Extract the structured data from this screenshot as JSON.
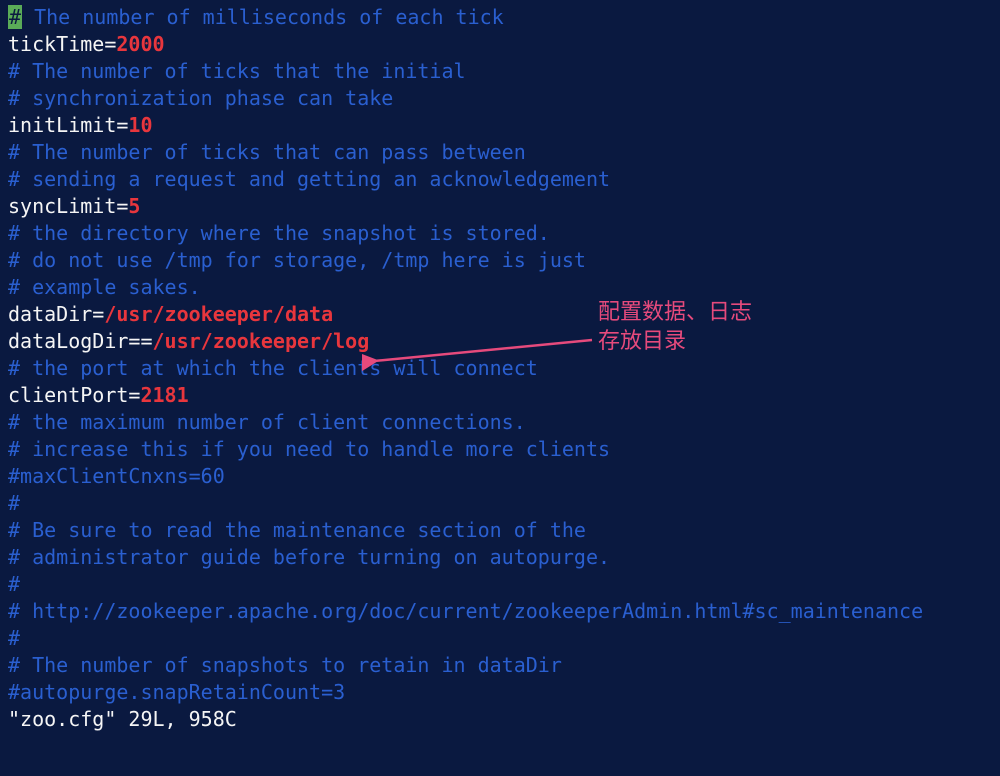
{
  "lines": {
    "l1_cursor": "#",
    "l1_rest": " The number of milliseconds of each tick",
    "l2_key": "tickTime",
    "l2_eq": "=",
    "l2_val": "2000",
    "l3": "# The number of ticks that the initial",
    "l4": "# synchronization phase can take",
    "l5_key": "initLimit",
    "l5_eq": "=",
    "l5_val": "10",
    "l6": "# The number of ticks that can pass between",
    "l7": "# sending a request and getting an acknowledgement",
    "l8_key": "syncLimit",
    "l8_eq": "=",
    "l8_val": "5",
    "l9": "# the directory where the snapshot is stored.",
    "l10": "# do not use /tmp for storage, /tmp here is just",
    "l11": "# example sakes.",
    "l12_key": "dataDir",
    "l12_eq": "=",
    "l12_val": "/usr/zookeeper/data",
    "l13_key": "dataLogDir",
    "l13_eq": "==",
    "l13_val": "/usr/zookeeper/log",
    "l14": "# the port at which the clients will connect",
    "l15_key": "clientPort",
    "l15_eq": "=",
    "l15_val": "2181",
    "l16": "# the maximum number of client connections.",
    "l17": "# increase this if you need to handle more clients",
    "l18": "#maxClientCnxns=60",
    "l19": "#",
    "l20": "# Be sure to read the maintenance section of the",
    "l21": "# administrator guide before turning on autopurge.",
    "l22": "#",
    "l23": "# http://zookeeper.apache.org/doc/current/zookeeperAdmin.html#sc_maintenance",
    "l24": "#",
    "l25": "# The number of snapshots to retain in dataDir",
    "l26": "#autopurge.snapRetainCount=3",
    "status": "\"zoo.cfg\" 29L, 958C"
  },
  "annotation": {
    "line1": "配置数据、日志",
    "line2": "存放目录"
  }
}
